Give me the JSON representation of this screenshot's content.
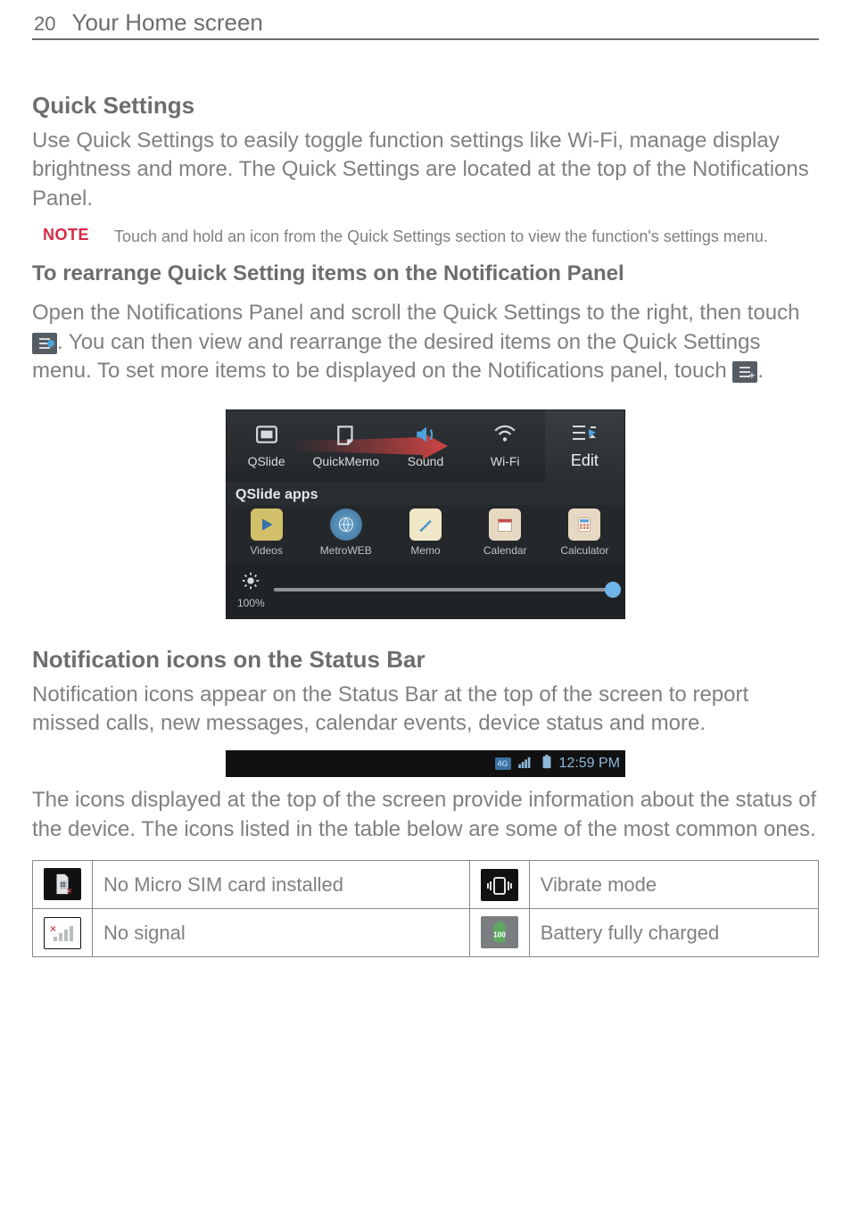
{
  "header": {
    "page_number": "20",
    "title": "Your Home screen"
  },
  "section1": {
    "heading": "Quick Settings",
    "body": "Use Quick Settings to easily toggle function settings like Wi-Fi, manage display brightness and more. The Quick Settings are located at the top of the Notifications Panel.",
    "note_label": "NOTE",
    "note_text": "Touch and hold an icon from the Quick Settings section to view the function's settings menu.",
    "subheading": "To rearrange Quick Setting items on the Notification Panel",
    "body2_a": "Open the Notifications Panel and scroll the Quick Settings to the right, then touch ",
    "body2_b": ". You can then view and rearrange the desired items on the Quick Settings menu. To set more items to be displayed on the Notifications panel, touch ",
    "body2_c": "."
  },
  "panel": {
    "qs": {
      "items": [
        {
          "label": "QSlide"
        },
        {
          "label": "QuickMemo"
        },
        {
          "label": "Sound"
        },
        {
          "label": "Wi-Fi"
        }
      ],
      "edit_label": "Edit"
    },
    "apps_title": "QSlide apps",
    "apps": [
      {
        "label": "Videos"
      },
      {
        "label": "MetroWEB"
      },
      {
        "label": "Memo"
      },
      {
        "label": "Calendar"
      },
      {
        "label": "Calculator"
      }
    ],
    "brightness_label": "100%"
  },
  "section2": {
    "heading": "Notification icons on the Status Bar",
    "body1": "Notification icons appear on the Status Bar at the top of the screen to report missed calls, new messages, calendar events, device status and more.",
    "status_time": "12:59 PM",
    "body2": "The icons displayed at the top of the screen provide information about the status of the device. The icons listed in the table below are some of the most common ones."
  },
  "icon_table": {
    "rows": [
      {
        "left": "No Micro SIM card installed",
        "right": "Vibrate mode"
      },
      {
        "left": "No signal",
        "right": "Battery fully charged"
      }
    ]
  }
}
